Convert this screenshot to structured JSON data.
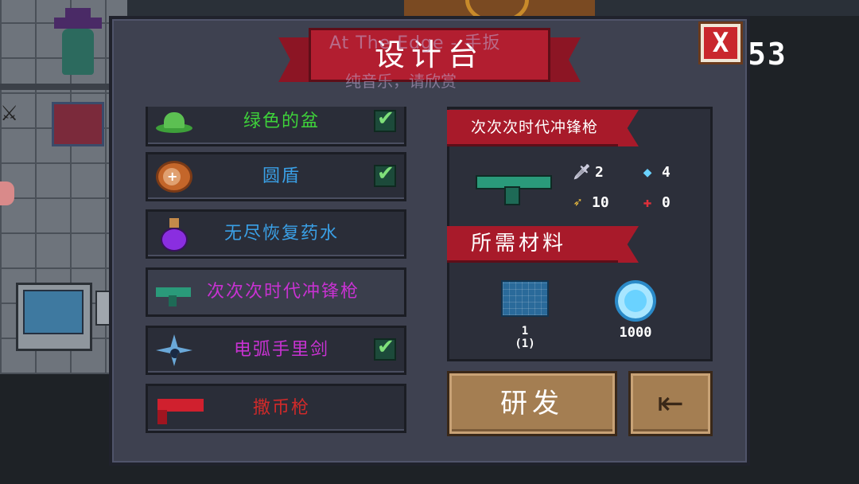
{
  "title": "设计台",
  "watermark": {
    "line1": "At The Edge - 手扳",
    "line2": "纯音乐，请欣赏"
  },
  "score": "53",
  "close_label": "X",
  "items": [
    {
      "label": "绿色的盆",
      "color": "#3ed23a",
      "checked": true,
      "icon": "green-hat-icon"
    },
    {
      "label": "圆盾",
      "color": "#3aa0e6",
      "checked": true,
      "icon": "round-shield-icon"
    },
    {
      "label": "无尽恢复药水",
      "color": "#3aa0e6",
      "checked": false,
      "icon": "potion-icon"
    },
    {
      "label": "次次次时代冲锋枪",
      "color": "#c832d2",
      "checked": false,
      "icon": "smg-icon",
      "selected": true
    },
    {
      "label": "电弧手里剑",
      "color": "#c832d2",
      "checked": true,
      "icon": "shuriken-icon"
    },
    {
      "label": "撒币枪",
      "color": "#d02a2a",
      "checked": false,
      "icon": "coin-gun-icon"
    }
  ],
  "detail": {
    "weapon_name": "次次次时代冲锋枪",
    "stats": {
      "attack": "2",
      "energy": "4",
      "crit": "10",
      "deviation": "0"
    },
    "materials_title": "所需材料",
    "materials": [
      {
        "name": "blueprint-icon",
        "quantity_line1": "1",
        "quantity_line2": "(1)"
      },
      {
        "name": "gem-icon",
        "quantity_line1": "1000"
      }
    ]
  },
  "buttons": {
    "research": "研发",
    "exit": "⇤"
  },
  "colors": {
    "panel": "#3e4150",
    "ribbon": "#a81a2a",
    "button": "#a47e52"
  }
}
